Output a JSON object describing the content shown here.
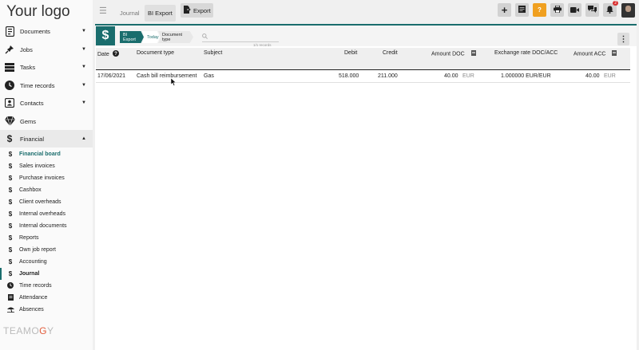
{
  "logo": "Your logo",
  "sidebar": {
    "items": [
      {
        "label": "Documents",
        "icon": "document-icon",
        "caret": "▼"
      },
      {
        "label": "Jobs",
        "icon": "pin-icon",
        "caret": "▼"
      },
      {
        "label": "Tasks",
        "icon": "tasks-icon",
        "caret": "▼"
      },
      {
        "label": "Time records",
        "icon": "clock-icon",
        "caret": "▼"
      },
      {
        "label": "Contacts",
        "icon": "contacts-icon",
        "caret": "▼"
      },
      {
        "label": "Gems",
        "icon": "gem-icon",
        "caret": ""
      },
      {
        "label": "Financial",
        "icon": "dollar-icon",
        "caret": "▲"
      }
    ],
    "sub_items": [
      {
        "label": "Financial board",
        "icon": "dollar-icon"
      },
      {
        "label": "Sales invoices",
        "icon": "dollar-icon"
      },
      {
        "label": "Purchase invoices",
        "icon": "dollar-icon"
      },
      {
        "label": "Cashbox",
        "icon": "dollar-icon"
      },
      {
        "label": "Client overheads",
        "icon": "dollar-icon"
      },
      {
        "label": "Internal overheads",
        "icon": "dollar-icon"
      },
      {
        "label": "Internal documents",
        "icon": "dollar-icon"
      },
      {
        "label": "Reports",
        "icon": "dollar-icon"
      },
      {
        "label": "Own job report",
        "icon": "dollar-icon"
      },
      {
        "label": "Accounting",
        "icon": "dollar-icon"
      },
      {
        "label": "Journal",
        "icon": "dollar-icon"
      },
      {
        "label": "Time records",
        "icon": "clock-icon"
      },
      {
        "label": "Attendance",
        "icon": "attendance-icon"
      },
      {
        "label": "Absences",
        "icon": "beach-icon"
      }
    ],
    "footer_logo_a": "TEAMO",
    "footer_logo_b": "G",
    "footer_logo_c": "Y"
  },
  "topbar": {
    "tabs": [
      "Journal",
      "BI Export"
    ],
    "export_label": "Export",
    "notification_count": "2",
    "help_label": "?"
  },
  "panel": {
    "dollar": "$",
    "breadcrumbs": [
      "BI Export",
      "Today",
      "Document type"
    ],
    "records": "1/1 records"
  },
  "table": {
    "headers": [
      "Date",
      "Document type",
      "Subject",
      "Debit",
      "Credit",
      "Amount DOC",
      "Exchange rate DOC/ACC",
      "Amount ACC"
    ],
    "rows": [
      {
        "date": "17/06/2021",
        "document_type": "Cash bill reimbursement",
        "subject": "Gas",
        "debit": "518.000",
        "credit": "211.000",
        "amount_doc": "40.00",
        "amount_doc_currency": "EUR",
        "exchange_rate": "1.000000 EUR/EUR",
        "amount_acc": "40.00",
        "amount_acc_currency": "EUR"
      }
    ]
  },
  "colors": {
    "accent": "#1a6d6d",
    "help": "#f0a020",
    "badge": "#d93030"
  }
}
